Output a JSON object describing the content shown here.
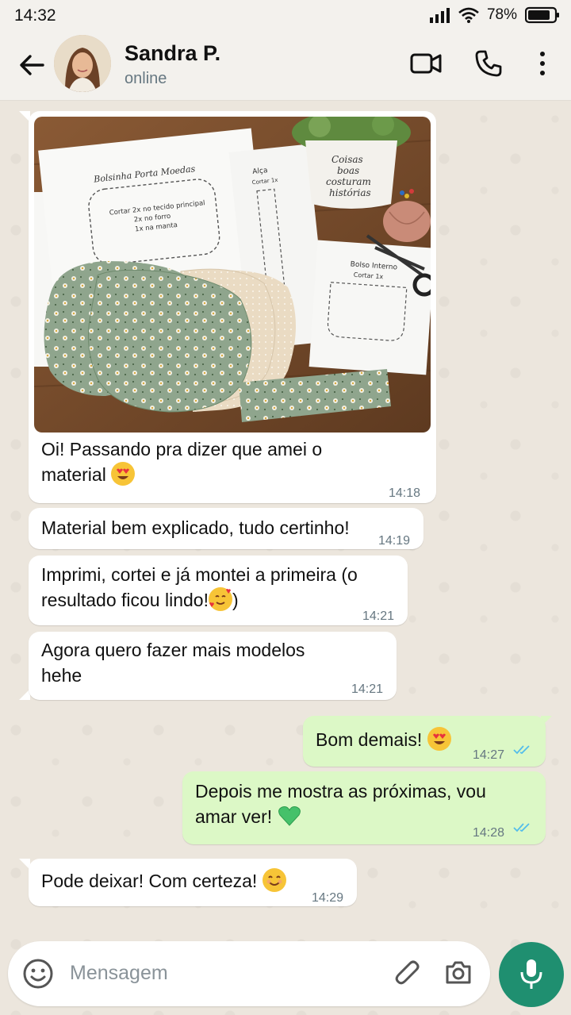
{
  "status_bar": {
    "time": "14:32",
    "battery": "78%"
  },
  "header": {
    "contact_name": "Sandra P.",
    "presence": "online"
  },
  "messages": [
    {
      "direction": "in",
      "has_image": true,
      "text": "Oi! Passando pra dizer que amei o material",
      "emoji": "heart-eyes",
      "time": "14:18"
    },
    {
      "direction": "in",
      "text": "Material bem explicado, tudo certinho!",
      "time": "14:19"
    },
    {
      "direction": "in",
      "text": "Imprimi, cortei e já montei a primeira (o resultado ficou lindo!",
      "text_after_emoji": ")",
      "emoji": "smiling-hearts",
      "time": "14:21"
    },
    {
      "direction": "in",
      "text": "Agora quero fazer mais modelos hehe",
      "time": "14:21"
    },
    {
      "direction": "out",
      "text": "Bom demais!",
      "emoji": "heart-eyes",
      "time": "14:27",
      "status": "read"
    },
    {
      "direction": "out",
      "text": "Depois me mostra as próximas, vou amar ver!",
      "emoji": "green-heart",
      "time": "14:28",
      "status": "read"
    },
    {
      "direction": "in",
      "text": "Pode deixar! Com certeza!",
      "emoji": "smile",
      "time": "14:29"
    }
  ],
  "image": {
    "pattern1_title": "Bolsinha Porta Moedas",
    "pattern1_instructions": "Cortar 2x no tecido principal\n2x no forro\n1x na manta",
    "pattern2_title": "Alça",
    "pattern2_sub": "Cortar 1x",
    "pattern3_title": "Bolso Interno",
    "pattern3_sub": "Cortar 1x",
    "pot_text": "Coisas\nboas\ncosturam\nhistórias"
  },
  "composer": {
    "placeholder": "Mensagem"
  },
  "colors": {
    "accent": "#1f8f70",
    "outgoing_bubble": "#dcf8c6",
    "read_ticks": "#53bdeb"
  }
}
